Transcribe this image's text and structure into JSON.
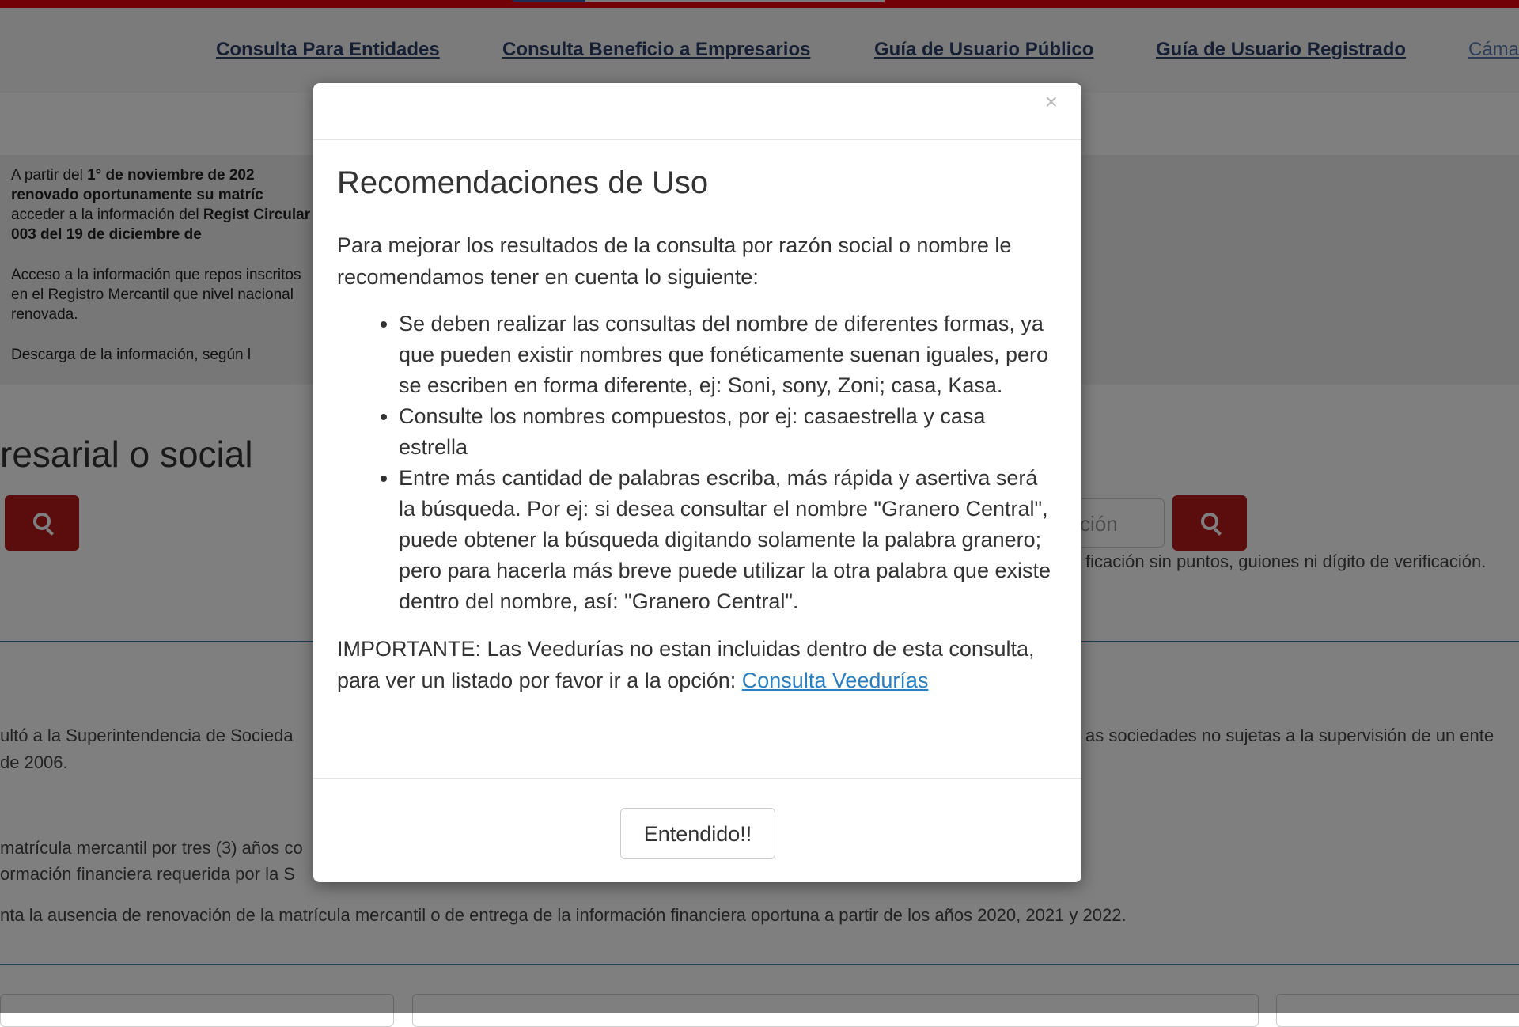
{
  "nav": {
    "links": [
      "Consulta Para Entidades",
      "Consulta Beneficio a Empresarios",
      "Guía de Usuario Público",
      "Guía de Usuario Registrado",
      "Cáma"
    ]
  },
  "hero": {
    "p1_a": "A partir del ",
    "p1_b": "1° de noviembre de 202",
    "p1_c": "renovado oportunamente su matríc",
    "p1_d": "acceder a la información del ",
    "p1_e": "Regist",
    "p1_f": "Circular 003 del 19 de diciembre de",
    "p2": "Acceso a la información que repos inscritos en el Registro Mercantil que nivel nacional renovada.",
    "p3": "Descarga de la información, según l"
  },
  "search": {
    "title": "resarial o social",
    "input_placeholder": "ción",
    "help": "ficación sin puntos, guiones ni dígito de verificación."
  },
  "background_text": {
    "line1_left": "ultó a la Superintendencia de Socieda",
    "line1_right": "as sociedades no sujetas a la supervisión de un ente",
    "line2": "de 2006.",
    "line3": "matrícula mercantil por tres (3) años co",
    "line4": "ormación financiera requerida por la S",
    "line5": "nta la ausencia de renovación de la matrícula mercantil o de entrega de la información financiera oportuna a partir de los años 2020, 2021 y 2022."
  },
  "modal": {
    "close_symbol": "×",
    "title": "Recomendaciones de Uso",
    "intro": "Para mejorar los resultados de la consulta por razón social o nombre le recomendamos tener en cuenta lo siguiente:",
    "bullets": [
      "Se deben realizar las consultas del nombre de diferentes formas, ya que pueden existir nombres que fonéticamente suenan iguales, pero se escriben en forma diferente, ej: Soni, sony, Zoni; casa, Kasa.",
      "Consulte los nombres compuestos, por ej: casaestrella y casa estrella",
      "Entre más cantidad de palabras escriba, más rápida y asertiva será la búsqueda. Por ej: si desea consultar el nombre \"Granero Central\", puede obtener la búsqueda digitando solamente la palabra granero; pero para hacerla más breve puede utilizar la otra palabra que existe dentro del nombre, así: \"Granero Central\"."
    ],
    "important": "IMPORTANTE: Las Veedurías no estan incluidas dentro de esta consulta, para ver un listado por favor ir a la opción: ",
    "important_link": "Consulta Veedurías",
    "ok_button": "Entendido!!"
  },
  "colors": {
    "brand_red": "#e3000f",
    "button_red": "#b71b1b",
    "link_blue": "#2b7ec0"
  }
}
